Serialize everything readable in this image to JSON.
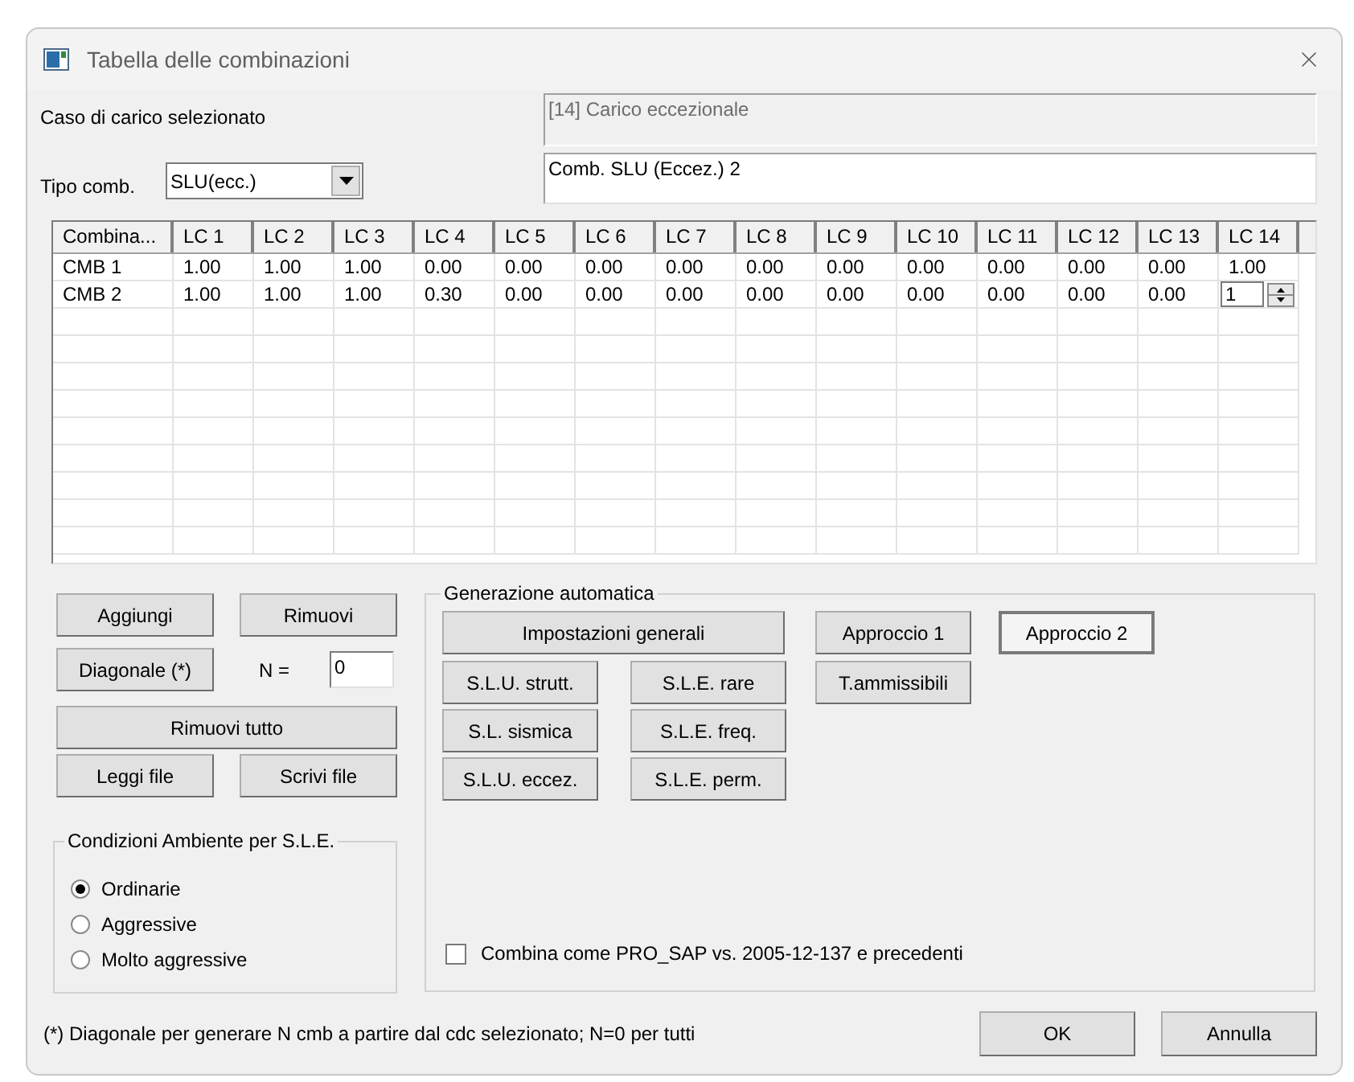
{
  "window": {
    "title": "Tabella delle combinazioni"
  },
  "selected_case": {
    "label": "Caso di carico selezionato",
    "value": "[14] Carico eccezionale"
  },
  "comb_type": {
    "label": "Tipo comb.",
    "value": "SLU(ecc.)"
  },
  "comb_name": {
    "value": "Comb. SLU (Eccez.) 2"
  },
  "table": {
    "columns": [
      "Combina...",
      "LC 1",
      "LC 2",
      "LC 3",
      "LC 4",
      "LC 5",
      "LC 6",
      "LC 7",
      "LC 8",
      "LC 9",
      "LC 10",
      "LC 11",
      "LC 12",
      "LC 13",
      "LC 14"
    ],
    "rows": [
      {
        "cells": [
          "CMB 1",
          "1.00",
          "1.00",
          "1.00",
          "0.00",
          "0.00",
          "0.00",
          "0.00",
          "0.00",
          "0.00",
          "0.00",
          "0.00",
          "0.00",
          "0.00",
          "1.00"
        ]
      },
      {
        "cells": [
          "CMB 2",
          "1.00",
          "1.00",
          "1.00",
          "0.30",
          "0.00",
          "0.00",
          "0.00",
          "0.00",
          "0.00",
          "0.00",
          "0.00",
          "0.00",
          "0.00",
          {
            "kind": "spin",
            "value": "1"
          }
        ]
      }
    ]
  },
  "left_buttons": {
    "add": "Aggiungi",
    "remove": "Rimuovi",
    "diagonal": "Diagonale (*)",
    "n_label": "N =",
    "n_value": "0",
    "remove_all": "Rimuovi tutto",
    "read": "Leggi file",
    "write": "Scrivi file"
  },
  "environment": {
    "title": "Condizioni Ambiente per S.L.E.",
    "options": [
      {
        "label": "Ordinarie",
        "selected": true
      },
      {
        "label": "Aggressive",
        "selected": false
      },
      {
        "label": "Molto aggressive",
        "selected": false
      }
    ]
  },
  "auto_generation": {
    "title": "Generazione automatica",
    "general": "Impostazioni generali",
    "approaches": [
      {
        "label": "Approccio 1",
        "selected": false
      },
      {
        "label": "Approccio 2",
        "selected": true
      }
    ],
    "slu_buttons": [
      "S.L.U. strutt.",
      "S.L. sismica",
      "S.L.U. eccez."
    ],
    "sle_buttons": [
      "S.L.E. rare",
      "S.L.E. freq.",
      "S.L.E. perm."
    ],
    "allowable": "T.ammissibili",
    "legacy": {
      "label": "Combina come PRO_SAP vs. 2005-12-137 e precedenti",
      "checked": false
    }
  },
  "footnote": "(*) Diagonale per generare N cmb a partire dal cdc selezionato; N=0 per tutti",
  "buttons": [
    "OK",
    "Annulla"
  ]
}
